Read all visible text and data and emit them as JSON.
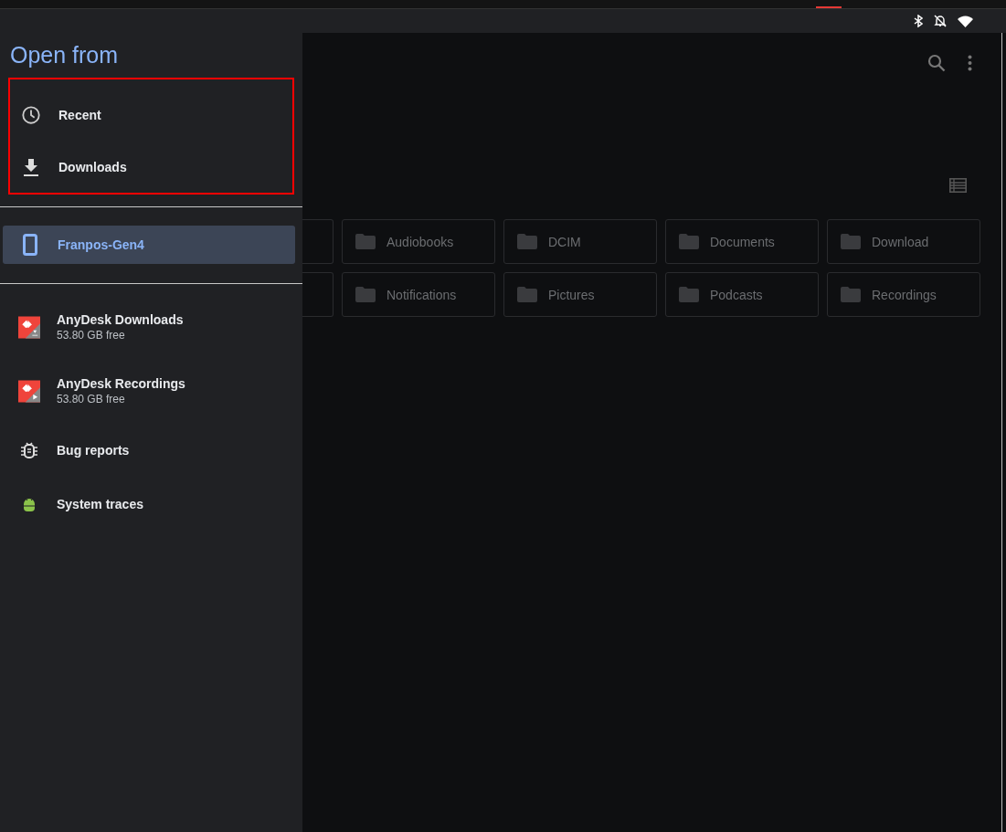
{
  "drawer": {
    "title": "Open from",
    "sections": [
      {
        "highlighted": true,
        "items": [
          {
            "kind": "clock",
            "label": "Recent",
            "selected": false
          },
          {
            "kind": "download",
            "label": "Downloads",
            "selected": false
          }
        ]
      },
      {
        "highlighted": false,
        "items": [
          {
            "kind": "device",
            "label": "Franpos-Gen4",
            "selected": true
          }
        ]
      },
      {
        "highlighted": false,
        "items": [
          {
            "kind": "anydesk-download",
            "label": "AnyDesk Downloads",
            "detail": "53.80 GB free",
            "selected": false
          },
          {
            "kind": "anydesk-record",
            "label": "AnyDesk Recordings",
            "detail": "53.80 GB free",
            "selected": false
          },
          {
            "kind": "bug",
            "label": "Bug reports",
            "selected": false
          },
          {
            "kind": "android",
            "label": "System traces",
            "selected": false
          }
        ]
      }
    ]
  },
  "folders": [
    "Audiobooks",
    "DCIM",
    "Documents",
    "Download",
    "Notifications",
    "Pictures",
    "Podcasts",
    "Recordings"
  ]
}
